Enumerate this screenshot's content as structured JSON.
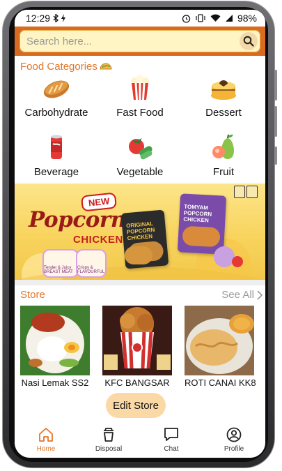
{
  "status_bar": {
    "time": "12:29",
    "battery": "98%"
  },
  "search": {
    "placeholder": "Search here..."
  },
  "categories": {
    "title": "Food Categories",
    "items": [
      {
        "label": "Carbohydrate",
        "icon": "bread-icon"
      },
      {
        "label": "Fast Food",
        "icon": "popcorn-icon"
      },
      {
        "label": "Dessert",
        "icon": "cake-icon"
      },
      {
        "label": "Beverage",
        "icon": "soda-can-icon"
      },
      {
        "label": "Vegetable",
        "icon": "vegetable-icon"
      },
      {
        "label": "Fruit",
        "icon": "fruit-icon"
      }
    ]
  },
  "banner": {
    "badge": "NEW",
    "title_line1": "Popcorn",
    "title_line2": "CHICKEN",
    "chip1": "Tender & Juicy BREAST MEAT",
    "chip2": "Crispy & FLAVOURFUL",
    "pack1": "ORIGINAL POPCORN CHICKEN",
    "pack2": "TOMYAM POPCORN CHICKEN"
  },
  "store": {
    "title": "Store",
    "see_all": "See All",
    "items": [
      {
        "name": "Nasi Lemak SS2"
      },
      {
        "name": "KFC BANGSAR"
      },
      {
        "name": "ROTI CANAI KK8"
      }
    ],
    "edit_label": "Edit Store"
  },
  "nav": {
    "items": [
      {
        "label": "Home",
        "icon": "home-icon",
        "active": true
      },
      {
        "label": "Disposal",
        "icon": "disposal-cup-icon",
        "active": false
      },
      {
        "label": "Chat",
        "icon": "chat-icon",
        "active": false
      },
      {
        "label": "Profile",
        "icon": "profile-icon",
        "active": false
      }
    ]
  },
  "colors": {
    "accent": "#e0762a",
    "search_bar": "#d86b1f",
    "search_field": "#fff5c4",
    "edit_button": "#fbd9a6"
  }
}
